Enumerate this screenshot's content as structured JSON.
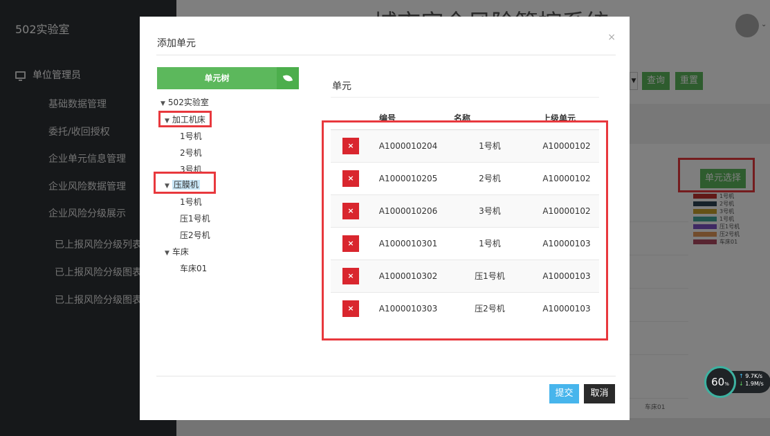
{
  "app": {
    "brand": "502实验室",
    "system_title": "城市安全风险管控系统",
    "sidebar": {
      "group": "单位管理员",
      "items": [
        "基础数据管理",
        "委托/收回授权",
        "企业单元信息管理",
        "企业风险数据管理",
        "企业风险分级展示",
        "已上报风险分级列表",
        "已上报风险分级图表",
        "已上报风险分级图表"
      ]
    },
    "toolbar": {
      "query": "查询",
      "reset": "重置"
    },
    "unit_select_button": "单元选择",
    "legend": [
      {
        "label": "1号机",
        "color": "#c23531"
      },
      {
        "label": "2号机",
        "color": "#2f4554"
      },
      {
        "label": "3号机",
        "color": "#c9a22d"
      },
      {
        "label": "1号机",
        "color": "#43a79b"
      },
      {
        "label": "压1号机",
        "color": "#7d52c7"
      },
      {
        "label": "压2号机",
        "color": "#e59a5a"
      },
      {
        "label": "车床01",
        "color": "#b04b62"
      }
    ],
    "x_label": "车床01"
  },
  "speed_widget": {
    "percent": "60",
    "unit": "%",
    "up": "9.7K/s",
    "down": "1.9M/s"
  },
  "modal": {
    "title": "添加单元",
    "close": "×",
    "tree_title": "单元树",
    "tree": {
      "root": "502实验室",
      "n1": "加工机床",
      "n1_1": "1号机",
      "n1_2": "2号机",
      "n1_3": "3号机",
      "n2": "压膜机",
      "n2_1": "1号机",
      "n2_2": "压1号机",
      "n2_3": "压2号机",
      "n3": "车床",
      "n3_1": "车床01"
    },
    "right_title": "单元",
    "columns": [
      "",
      "编号",
      "名称",
      "上级单元"
    ],
    "rows": [
      {
        "code": "A1000010204",
        "name": "1号机",
        "parent": "A10000102"
      },
      {
        "code": "A1000010205",
        "name": "2号机",
        "parent": "A10000102"
      },
      {
        "code": "A1000010206",
        "name": "3号机",
        "parent": "A10000102"
      },
      {
        "code": "A1000010301",
        "name": "1号机",
        "parent": "A10000103"
      },
      {
        "code": "A1000010302",
        "name": "压1号机",
        "parent": "A10000103"
      },
      {
        "code": "A1000010303",
        "name": "压2号机",
        "parent": "A10000103"
      }
    ],
    "delete_glyph": "×",
    "submit": "提交",
    "cancel": "取消"
  }
}
